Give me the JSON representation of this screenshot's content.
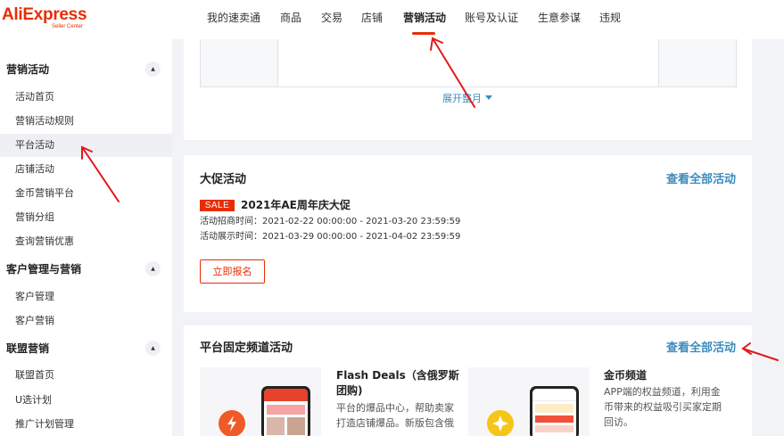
{
  "header": {
    "logo_brand": "AliExpress",
    "logo_sub": "Seller Center",
    "nav": [
      "我的速卖通",
      "商品",
      "交易",
      "店铺",
      "营销活动",
      "账号及认证",
      "生意参谋",
      "违规"
    ],
    "active_nav": "营销活动"
  },
  "sidebar": {
    "groups": [
      {
        "title": "营销活动",
        "items": [
          "活动首页",
          "营销活动规则",
          "平台活动",
          "店铺活动",
          "金币营销平台",
          "营销分组",
          "查询营销优惠"
        ]
      },
      {
        "title": "客户管理与营销",
        "items": [
          "客户管理",
          "客户营销"
        ]
      },
      {
        "title": "联盟营销",
        "items": [
          "联盟首页",
          "U选计划",
          "推广计划管理"
        ]
      }
    ],
    "active_item": "平台活动",
    "toggle_glyph": "▲"
  },
  "calendar_card": {
    "expand_label": "展开整月"
  },
  "promo_card": {
    "title": "大促活动",
    "view_all": "查看全部活动",
    "badge": "SALE",
    "event_title": "2021年AE周年庆大促",
    "recruit_line": "活动招商时间：2021-02-22 00:00:00 - 2021-03-20 23:59:59",
    "display_line": "活动展示时间：2021-03-29 00:00:00 - 2021-04-02 23:59:59",
    "register_button": "立即报名"
  },
  "channel_card": {
    "title": "平台固定频道活动",
    "view_all": "查看全部活动",
    "channels": [
      {
        "title_line1": "Flash Deals（含俄罗斯",
        "title_line2": "团购)",
        "desc_line1": "平台的爆品中心，帮助卖家",
        "desc_line2": "打造店铺爆品。新版包含俄",
        "icon": "lightning-icon",
        "icon_color": "#f05a28"
      },
      {
        "title_line1": "金币频道",
        "desc_line1": "APP端的权益频道，利用金",
        "desc_line2": "币带来的权益吸引买家定期",
        "desc_line3": "回访。",
        "icon": "coin-icon",
        "icon_color": "#f5c518"
      }
    ]
  },
  "colors": {
    "brand": "#e62e04",
    "link": "#3c8bbd",
    "arrow": "#e01b1b"
  }
}
